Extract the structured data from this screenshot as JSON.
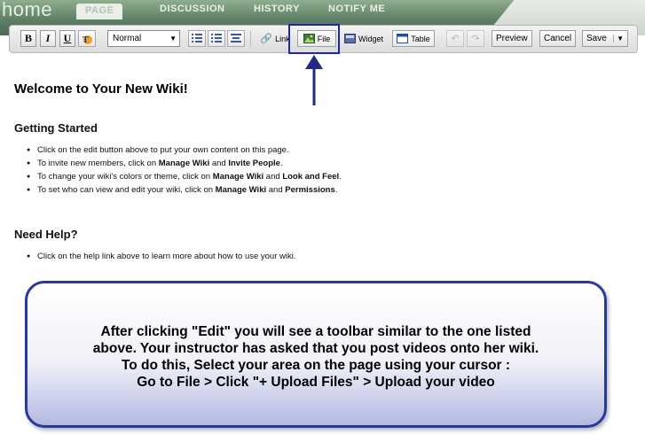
{
  "nav": {
    "home": "home",
    "tabs": [
      "PAGE",
      "DISCUSSION",
      "HISTORY",
      "NOTIFY ME"
    ]
  },
  "toolbar": {
    "bold": "B",
    "italic": "I",
    "underline": "U",
    "style_select": "Normal",
    "link": "Link",
    "file": "File",
    "widget": "Widget",
    "table": "Table",
    "preview": "Preview",
    "cancel": "Cancel",
    "save": "Save"
  },
  "page": {
    "title": "Welcome to Your New Wiki!",
    "getting_started": {
      "heading": "Getting Started",
      "items": [
        {
          "pre": "Click on the edit button above to put your own content on this page.",
          "b1": "",
          "mid": "",
          "b2": "",
          "post": ""
        },
        {
          "pre": "To invite new members, click on ",
          "b1": "Manage Wiki",
          "mid": " and ",
          "b2": "Invite People",
          "post": "."
        },
        {
          "pre": "To change your wiki's colors or theme, click on ",
          "b1": "Manage Wiki",
          "mid": " and ",
          "b2": "Look and Feel",
          "post": "."
        },
        {
          "pre": "To set who can view and edit your wiki, click on ",
          "b1": "Manage Wiki",
          "mid": " and ",
          "b2": "Permissions",
          "post": "."
        }
      ]
    },
    "need_help": {
      "heading": "Need Help?",
      "items": [
        {
          "pre": "Click on the help link above to learn more about how to use your wiki.",
          "b1": "",
          "mid": "",
          "b2": "",
          "post": ""
        }
      ]
    }
  },
  "callout": {
    "lines": [
      "After clicking \"Edit\" you will see a toolbar similar to the one listed",
      "above. Your instructor has asked that you post videos onto her wiki.",
      "To do this, Select your area on the page using your cursor :",
      "Go to File > Click  \"+ Upload Files\" > Upload your video"
    ]
  },
  "colors": {
    "highlight": "#1f2a9e",
    "callout_border": "#2a3896",
    "nav_green": "#5f7f66"
  },
  "icons": [
    "numbered-list-icon",
    "bullet-list-icon",
    "indent-icon",
    "link-icon",
    "file-icon",
    "widget-icon",
    "table-icon",
    "undo-icon",
    "redo-icon",
    "dropdown-arrow-icon",
    "arrow-up-icon"
  ]
}
